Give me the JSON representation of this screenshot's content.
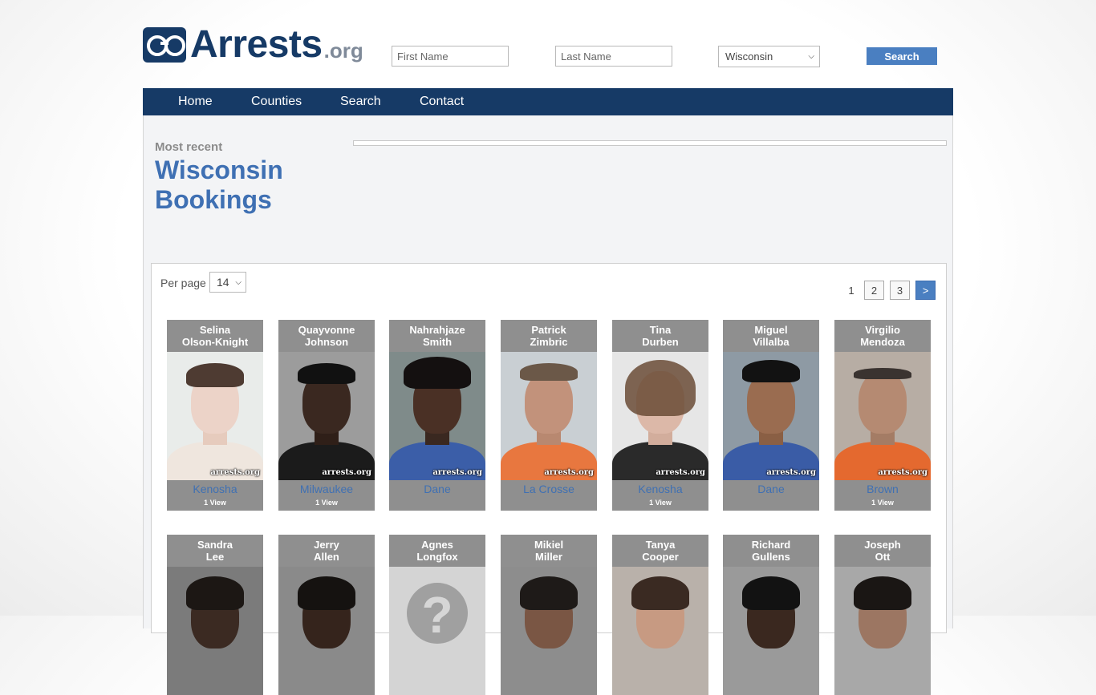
{
  "header": {
    "logo_text": "Arrests",
    "logo_suffix": ".org",
    "first_name_placeholder": "First Name",
    "last_name_placeholder": "Last Name",
    "state_selected": "Wisconsin",
    "search_label": "Search"
  },
  "nav": {
    "items": [
      "Home",
      "Counties",
      "Search",
      "Contact"
    ]
  },
  "heading": {
    "kicker": "Most recent",
    "title_line1": "Wisconsin",
    "title_line2": "Bookings"
  },
  "listing": {
    "per_page_label": "Per page",
    "per_page_value": "14",
    "pagination": {
      "current": "1",
      "pages": [
        "2",
        "3"
      ],
      "next": ">"
    },
    "watermark": "arrests.org",
    "rows": [
      [
        {
          "first": "Selina",
          "last": "Olson-Knight",
          "county": "Kenosha",
          "views": "1 View"
        },
        {
          "first": "Quayvonne",
          "last": "Johnson",
          "county": "Milwaukee",
          "views": "1 View"
        },
        {
          "first": "Nahrahjaze",
          "last": "Smith",
          "county": "Dane",
          "views": ""
        },
        {
          "first": "Patrick",
          "last": "Zimbric",
          "county": "La Crosse",
          "views": ""
        },
        {
          "first": "Tina",
          "last": "Durben",
          "county": "Kenosha",
          "views": "1 View"
        },
        {
          "first": "Miguel",
          "last": "Villalba",
          "county": "Dane",
          "views": ""
        },
        {
          "first": "Virgilio",
          "last": "Mendoza",
          "county": "Brown",
          "views": "1 View"
        }
      ],
      [
        {
          "first": "Sandra",
          "last": "Lee"
        },
        {
          "first": "Jerry",
          "last": "Allen"
        },
        {
          "first": "Agnes",
          "last": "Longfox"
        },
        {
          "first": "Mikiel",
          "last": "Miller"
        },
        {
          "first": "Tanya",
          "last": "Cooper"
        },
        {
          "first": "Richard",
          "last": "Gullens"
        },
        {
          "first": "Joseph",
          "last": "Ott"
        }
      ]
    ]
  },
  "colors": {
    "navy": "#163a66",
    "accent": "#4a7fc1",
    "link": "#3f70b3",
    "card_gray": "#8f8f8f"
  }
}
